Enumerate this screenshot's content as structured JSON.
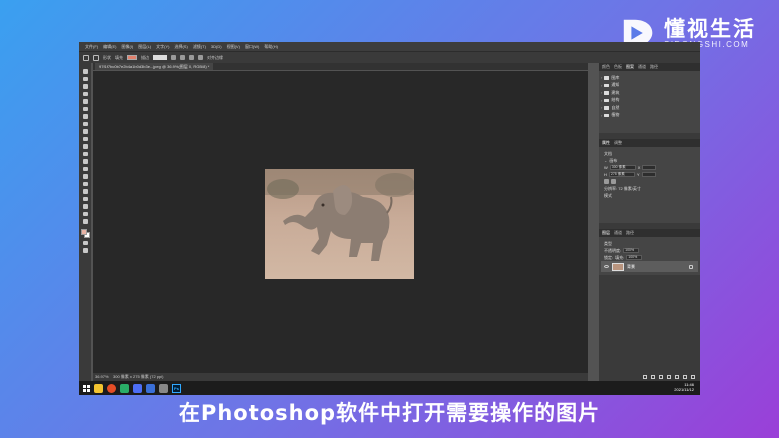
{
  "watermark": {
    "title": "懂视生活",
    "subtitle": "SIDONGSHI.COM"
  },
  "menu": [
    "文件(F)",
    "编辑(E)",
    "图像(I)",
    "图层(L)",
    "文字(Y)",
    "选择(S)",
    "滤镜(T)",
    "3D(D)",
    "视图(V)",
    "窗口(W)",
    "帮助(H)"
  ],
  "options": {
    "shape_label": "形状",
    "fill_label": "填充",
    "stroke_label": "描边",
    "align_label": "对齐边缘",
    "fill_color": "#e0806c"
  },
  "document": {
    "tab_title": "97f1f7bc0b7e2b4a1b0d3b3e...jpeg @ 36.9%(图层 0, RGB/8) *",
    "zoom": "36.97%",
    "dims": "300 像素 x 275 像素 (72 ppi)"
  },
  "panels": {
    "top_tabs": [
      "颜色",
      "色板",
      "图案",
      "通道",
      "路径"
    ],
    "layer_groups": [
      "图库",
      "通知",
      "建筑",
      "结构",
      "自然",
      "植物"
    ],
    "props_tabs": [
      "属性",
      "调整"
    ],
    "props": {
      "section": "文档",
      "section2": "画布",
      "w_label": "W",
      "w_value": "300 像素",
      "h_label": "H",
      "h_value": "275 像素",
      "x_label": "X",
      "y_label": "Y",
      "res": "分辨率: 72 像素/英寸",
      "mode": "模式"
    },
    "layers_tabs": [
      "图层",
      "通道",
      "路径"
    ],
    "layers_filter": "类型",
    "opacity_label": "不透明度:",
    "opacity_value": "100%",
    "fill_label2": "填充:",
    "fill_value": "100%",
    "lock_label": "锁定:",
    "layer_name": "背景"
  },
  "taskbar": {
    "time": "11:46",
    "date": "2021/11/12",
    "ps_label": "Ps"
  },
  "subtitle": "在Photoshop软件中打开需要操作的图片"
}
